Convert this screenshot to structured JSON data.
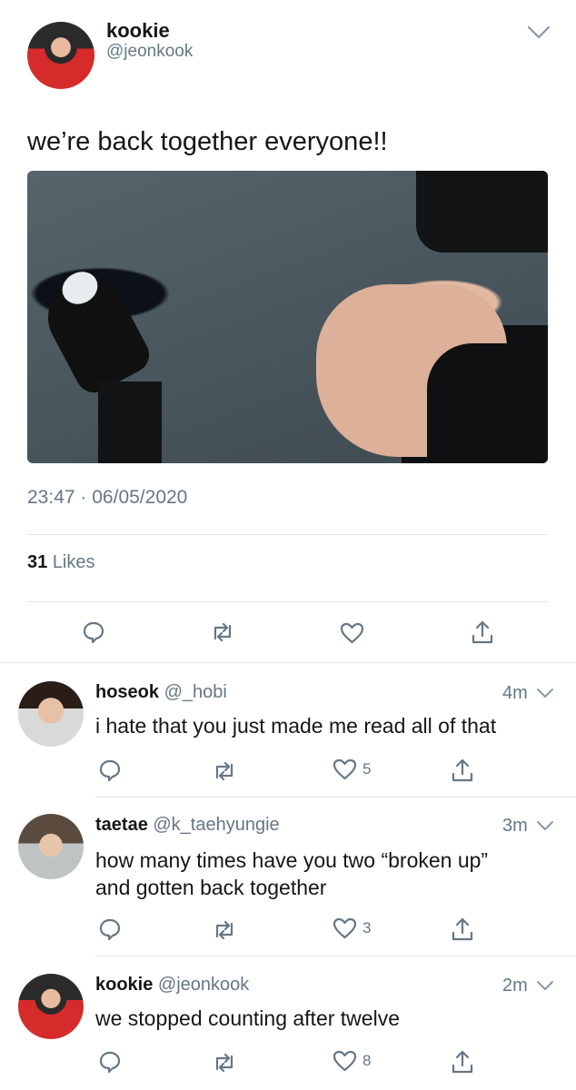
{
  "main_tweet": {
    "name": "kookie",
    "handle": "@jeonkook",
    "text": "we’re back together everyone!!",
    "time": "23:47",
    "separator": "·",
    "date": "06/05/2020",
    "likes_count": "31",
    "likes_label": "Likes"
  },
  "replies": [
    {
      "name": "hoseok",
      "handle": "@_hobi",
      "age": "4m",
      "text_lines": [
        "i hate that you just made me read all of that"
      ],
      "like_count": "5"
    },
    {
      "name": "taetae",
      "handle": "@k_taehyungie",
      "age": "3m",
      "text_lines": [
        "how many times have you two “broken up”",
        "and gotten back together"
      ],
      "like_count": "3"
    },
    {
      "name": "kookie",
      "handle": "@jeonkook",
      "age": "2m",
      "text_lines": [
        "we stopped counting after twelve"
      ],
      "like_count": "8"
    }
  ],
  "icons": {
    "reply": "reply-icon",
    "retweet": "retweet-icon",
    "like": "heart-icon",
    "share": "share-icon",
    "more": "chevron-down-icon"
  },
  "colors": {
    "text": "#14171a",
    "muted": "#657786",
    "divider": "#e1e8ed"
  }
}
